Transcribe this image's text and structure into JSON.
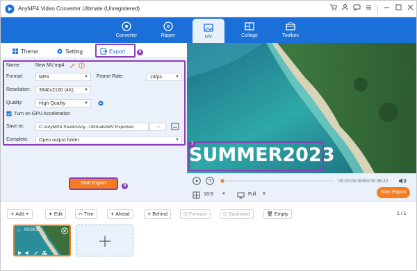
{
  "app": {
    "title": "AnyMP4 Video Converter Ultimate (Unregistered)"
  },
  "nav": [
    {
      "label": "Converter",
      "icon": "converter-icon"
    },
    {
      "label": "Ripper",
      "icon": "ripper-icon"
    },
    {
      "label": "MV",
      "icon": "mv-icon"
    },
    {
      "label": "Collage",
      "icon": "collage-icon"
    },
    {
      "label": "Toolbox",
      "icon": "toolbox-icon"
    }
  ],
  "tabs": {
    "theme": "Theme",
    "setting": "Setting",
    "export": "Export",
    "export_step": "6"
  },
  "form": {
    "name_label": "Name:",
    "name_value": "New MV.mp4",
    "format_label": "Format:",
    "format_value": "MP4",
    "framerate_label": "Frame Rate:",
    "framerate_value": "24fps",
    "resolution_label": "Resolution:",
    "resolution_value": "3840x2160 (4K)",
    "quality_label": "Quality:",
    "quality_value": "High Quality",
    "gpu_label": "Turn on GPU Acceleration",
    "saveto_label": "Save to:",
    "saveto_value": "C:\\AnyMP4 Studio\\Any...Ultimate\\MV Exported",
    "saveto_more": "···",
    "complete_label": "Complete:",
    "complete_value": "Open output folder",
    "form_step": "7"
  },
  "start_export": {
    "label": "Start Export",
    "step": "8"
  },
  "preview": {
    "overlay_text": "SUMMER2023",
    "time": "00:00:00.00/00:00:36.22",
    "aspect": "16:9",
    "fit": "Full",
    "export_label": "Start Export",
    "progress": 0.0
  },
  "toolbar": {
    "add": "Add",
    "edit": "Edit",
    "trim": "Trim",
    "ahead": "Ahead",
    "behind": "Behind",
    "forward": "Forward",
    "backward": "Backward",
    "empty": "Empty",
    "page": "1 / 1"
  },
  "timeline": {
    "clip_time": "00:00:3"
  },
  "colors": {
    "brand": "#1a6fd8",
    "accent": "#f57c20",
    "highlight": "#8b3db8"
  }
}
